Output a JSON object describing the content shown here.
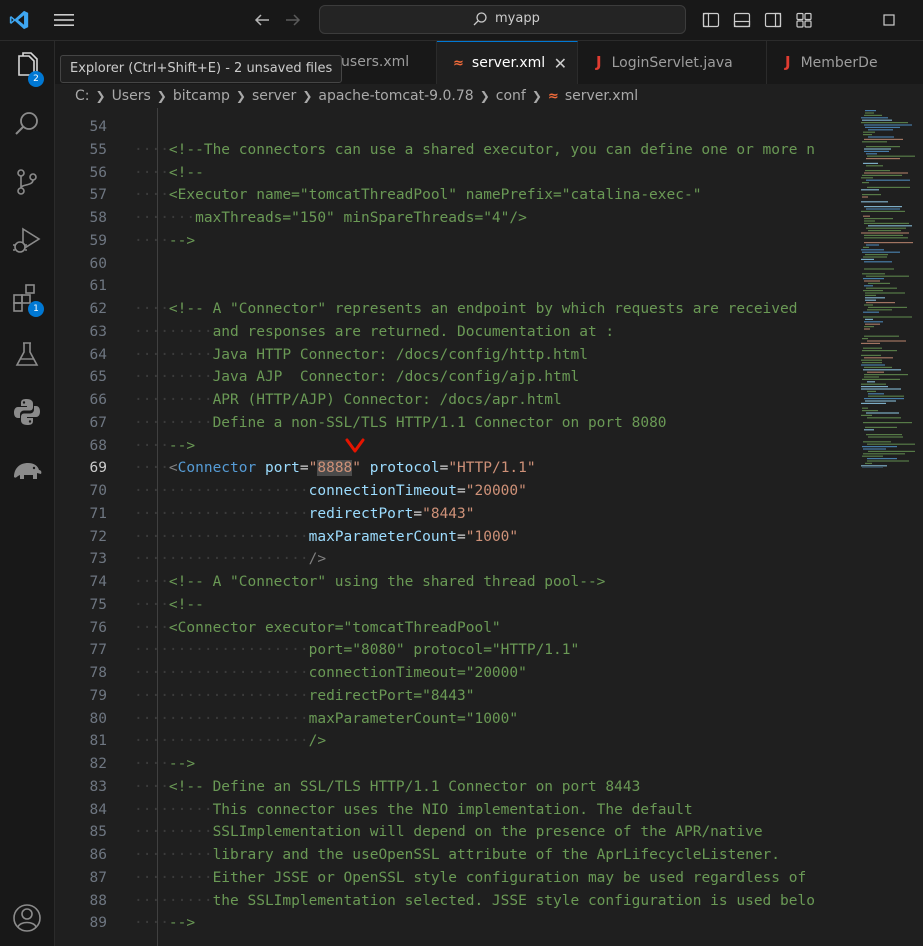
{
  "titlebar": {
    "search_text": "myapp",
    "icons": [
      "vscode-logo-icon",
      "menu-icon",
      "back-arrow-icon",
      "forward-arrow-icon",
      "search-icon",
      "toggle-sidebar-icon",
      "toggle-panel-icon",
      "toggle-secondary-sidebar-icon",
      "customize-layout-icon",
      "maximize-icon"
    ]
  },
  "activity": {
    "items": [
      "explorer-icon",
      "search-icon",
      "source-control-icon",
      "run-debug-icon",
      "extensions-icon",
      "testing-icon",
      "python-icon",
      "database-icon",
      "account-icon"
    ],
    "explorer_badge": "2",
    "extensions_badge": "1",
    "tooltip": "Explorer (Ctrl+Shift+E) - 2 unsaved files"
  },
  "tabs": [
    {
      "label": "-users.xml",
      "type": "xml",
      "active": false
    },
    {
      "label": "server.xml",
      "type": "xml",
      "active": true,
      "close": "✕"
    },
    {
      "label": "LoginServlet.java",
      "type": "java",
      "active": false
    },
    {
      "label": "MemberDe",
      "type": "java",
      "active": false
    }
  ],
  "breadcrumbs": [
    "C:",
    "Users",
    "bitcamp",
    "server",
    "apache-tomcat-9.0.78",
    "conf",
    "server.xml"
  ],
  "editor": {
    "current_line": 69,
    "lines": [
      {
        "n": "54",
        "i": 0,
        "t": [
          [
            "",
            ""
          ]
        ]
      },
      {
        "n": "55",
        "i": 1,
        "t": [
          [
            "c-com",
            "<!--The connectors can use a shared executor, you can define one or more n"
          ]
        ]
      },
      {
        "n": "56",
        "i": 1,
        "t": [
          [
            "c-com",
            "<!--"
          ]
        ]
      },
      {
        "n": "57",
        "i": 1,
        "t": [
          [
            "c-com",
            "<Executor name=\"tomcatThreadPool\" namePrefix=\"catalina-exec-\""
          ]
        ]
      },
      {
        "n": "58",
        "i": 2,
        "t": [
          [
            "c-com",
            "maxThreads=\"150\" minSpareThreads=\"4\"/>"
          ]
        ]
      },
      {
        "n": "59",
        "i": 1,
        "t": [
          [
            "c-com",
            "-->"
          ]
        ]
      },
      {
        "n": "60",
        "i": 0,
        "t": [
          [
            "",
            ""
          ]
        ]
      },
      {
        "n": "61",
        "i": 0,
        "t": [
          [
            "",
            ""
          ]
        ]
      },
      {
        "n": "62",
        "i": 1,
        "t": [
          [
            "c-com",
            "<!-- A \"Connector\" represents an endpoint by which requests are received"
          ]
        ]
      },
      {
        "n": "63",
        "i": 3,
        "t": [
          [
            "c-com",
            "and responses are returned. Documentation at :"
          ]
        ]
      },
      {
        "n": "64",
        "i": 3,
        "t": [
          [
            "c-com",
            "Java HTTP Connector: /docs/config/http.html"
          ]
        ]
      },
      {
        "n": "65",
        "i": 3,
        "t": [
          [
            "c-com",
            "Java AJP  Connector: /docs/config/ajp.html"
          ]
        ]
      },
      {
        "n": "66",
        "i": 3,
        "t": [
          [
            "c-com",
            "APR (HTTP/AJP) Connector: /docs/apr.html"
          ]
        ]
      },
      {
        "n": "67",
        "i": 3,
        "t": [
          [
            "c-com",
            "Define a non-SSL/TLS HTTP/1.1 Connector on port 8080"
          ]
        ]
      },
      {
        "n": "68",
        "i": 1,
        "t": [
          [
            "c-com",
            "-->"
          ]
        ]
      },
      {
        "n": "69",
        "i": 1,
        "t": [
          [
            "c-punc",
            "<"
          ],
          [
            "c-tag",
            "Connector"
          ],
          [
            "",
            " "
          ],
          [
            "c-attr",
            "port"
          ],
          [
            "",
            "="
          ],
          [
            "c-str",
            "\""
          ],
          [
            "c-str c-hl",
            "8888"
          ],
          [
            "c-str",
            "\""
          ],
          [
            "",
            " "
          ],
          [
            "c-attr",
            "protocol"
          ],
          [
            "",
            "="
          ],
          [
            "c-str",
            "\"HTTP/1.1\""
          ]
        ]
      },
      {
        "n": "70",
        "i": 5,
        "t": [
          [
            "c-attr",
            "connectionTimeout"
          ],
          [
            "",
            "="
          ],
          [
            "c-str",
            "\"20000\""
          ]
        ]
      },
      {
        "n": "71",
        "i": 5,
        "t": [
          [
            "c-attr",
            "redirectPort"
          ],
          [
            "",
            "="
          ],
          [
            "c-str",
            "\"8443\""
          ]
        ]
      },
      {
        "n": "72",
        "i": 5,
        "t": [
          [
            "c-attr",
            "maxParameterCount"
          ],
          [
            "",
            "="
          ],
          [
            "c-str",
            "\"1000\""
          ]
        ]
      },
      {
        "n": "73",
        "i": 5,
        "t": [
          [
            "c-punc",
            "/>"
          ]
        ]
      },
      {
        "n": "74",
        "i": 1,
        "t": [
          [
            "c-com",
            "<!-- A \"Connector\" using the shared thread pool-->"
          ]
        ]
      },
      {
        "n": "75",
        "i": 1,
        "t": [
          [
            "c-com",
            "<!--"
          ]
        ]
      },
      {
        "n": "76",
        "i": 1,
        "t": [
          [
            "c-com",
            "<Connector executor=\"tomcatThreadPool\""
          ]
        ]
      },
      {
        "n": "77",
        "i": 5,
        "t": [
          [
            "c-com",
            "port=\"8080\" protocol=\"HTTP/1.1\""
          ]
        ]
      },
      {
        "n": "78",
        "i": 5,
        "t": [
          [
            "c-com",
            "connectionTimeout=\"20000\""
          ]
        ]
      },
      {
        "n": "79",
        "i": 5,
        "t": [
          [
            "c-com",
            "redirectPort=\"8443\""
          ]
        ]
      },
      {
        "n": "80",
        "i": 5,
        "t": [
          [
            "c-com",
            "maxParameterCount=\"1000\""
          ]
        ]
      },
      {
        "n": "81",
        "i": 5,
        "t": [
          [
            "c-com",
            "/>"
          ]
        ]
      },
      {
        "n": "82",
        "i": 1,
        "t": [
          [
            "c-com",
            "-->"
          ]
        ]
      },
      {
        "n": "83",
        "i": 1,
        "t": [
          [
            "c-com",
            "<!-- Define an SSL/TLS HTTP/1.1 Connector on port 8443"
          ]
        ]
      },
      {
        "n": "84",
        "i": 3,
        "t": [
          [
            "c-com",
            "This connector uses the NIO implementation. The default"
          ]
        ]
      },
      {
        "n": "85",
        "i": 3,
        "t": [
          [
            "c-com",
            "SSLImplementation will depend on the presence of the APR/native"
          ]
        ]
      },
      {
        "n": "86",
        "i": 3,
        "t": [
          [
            "c-com",
            "library and the useOpenSSL attribute of the AprLifecycleListener."
          ]
        ]
      },
      {
        "n": "87",
        "i": 3,
        "t": [
          [
            "c-com",
            "Either JSSE or OpenSSL style configuration may be used regardless of"
          ]
        ]
      },
      {
        "n": "88",
        "i": 3,
        "t": [
          [
            "c-com",
            "the SSLImplementation selected. JSSE style configuration is used belo"
          ]
        ]
      },
      {
        "n": "89",
        "i": 1,
        "t": [
          [
            "c-com",
            "-->"
          ]
        ]
      }
    ]
  },
  "colors": {
    "accent": "#0078d4",
    "marker": "#e51400"
  }
}
